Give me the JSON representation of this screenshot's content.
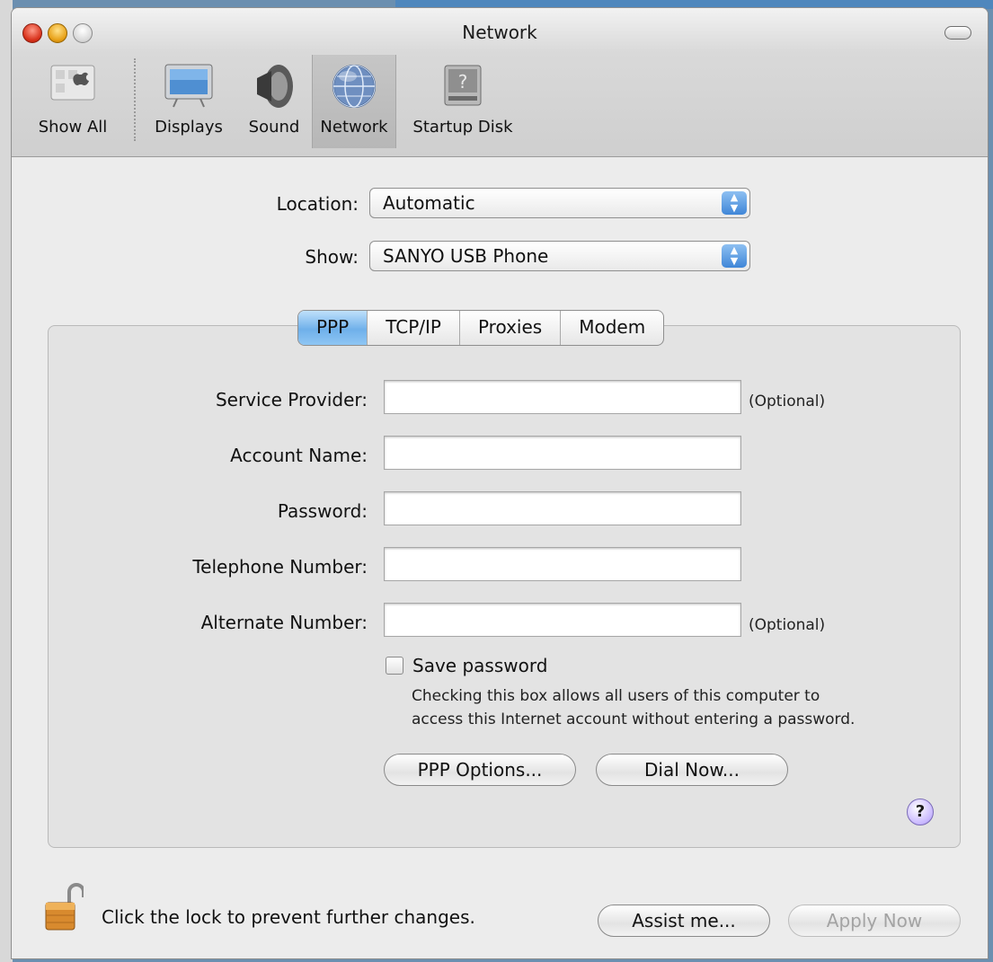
{
  "window": {
    "title": "Network"
  },
  "toolbar": {
    "items": [
      {
        "label": "Show All"
      },
      {
        "label": "Displays"
      },
      {
        "label": "Sound"
      },
      {
        "label": "Network"
      },
      {
        "label": "Startup Disk"
      }
    ],
    "selected": "Network"
  },
  "location": {
    "label": "Location:",
    "value": "Automatic"
  },
  "show": {
    "label": "Show:",
    "value": "SANYO USB Phone"
  },
  "tabs": [
    {
      "label": "PPP"
    },
    {
      "label": "TCP/IP"
    },
    {
      "label": "Proxies"
    },
    {
      "label": "Modem"
    }
  ],
  "active_tab": "PPP",
  "form": {
    "service_provider": {
      "label": "Service Provider:",
      "value": "",
      "hint": "(Optional)"
    },
    "account_name": {
      "label": "Account Name:",
      "value": ""
    },
    "password": {
      "label": "Password:",
      "value": ""
    },
    "telephone_number": {
      "label": "Telephone Number:",
      "value": ""
    },
    "alternate_number": {
      "label": "Alternate Number:",
      "value": "",
      "hint": "(Optional)"
    },
    "save_password": {
      "label": "Save password",
      "checked": false,
      "note_line1": "Checking this box allows all users of this computer to",
      "note_line2": "access this Internet account without entering a password."
    }
  },
  "buttons": {
    "ppp_options": "PPP Options...",
    "dial_now": "Dial Now...",
    "help": "?",
    "assist_me": "Assist me...",
    "apply_now": "Apply Now"
  },
  "lock": {
    "text": "Click the lock to prevent further changes."
  },
  "colors": {
    "tab_active": "#6fb0ea",
    "popup_arrows": "#3f86d8",
    "help": "#c8b7ff"
  }
}
